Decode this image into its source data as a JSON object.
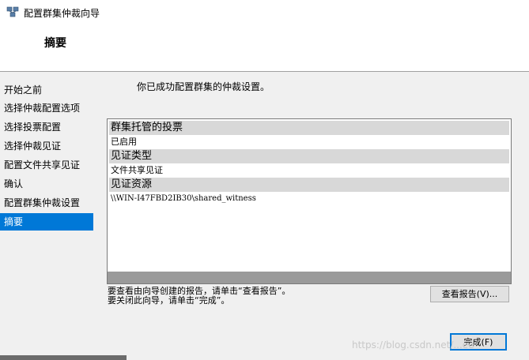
{
  "window": {
    "title": "配置群集仲裁向导"
  },
  "header": {
    "title": "摘要"
  },
  "sidebar": {
    "items": [
      {
        "label": "开始之前"
      },
      {
        "label": "选择仲裁配置选项"
      },
      {
        "label": "选择投票配置"
      },
      {
        "label": "选择仲裁见证"
      },
      {
        "label": "配置文件共享见证"
      },
      {
        "label": "确认"
      },
      {
        "label": "配置群集仲裁设置"
      },
      {
        "label": "摘要",
        "selected": true
      }
    ]
  },
  "main": {
    "intro": "你已成功配置群集的仲裁设置。",
    "report": {
      "sections": [
        {
          "heading": "群集托管的投票",
          "value": "已启用"
        },
        {
          "heading": "见证类型",
          "value": "文件共享见证"
        },
        {
          "heading": "见证资源",
          "value": "\\\\WIN-I47FBD2IB30\\shared_witness"
        }
      ]
    },
    "hint_line1": "要查看由向导创建的报告，请单击“查看报告”。",
    "hint_line2": "要关闭此向导，请单击“完成”。",
    "view_report_label": "查看报告(V)...",
    "finish_label": "完成(F)"
  },
  "watermark": "https://blog.csdn.net/...ee",
  "icons": {
    "title_icon": "cluster-icon"
  }
}
